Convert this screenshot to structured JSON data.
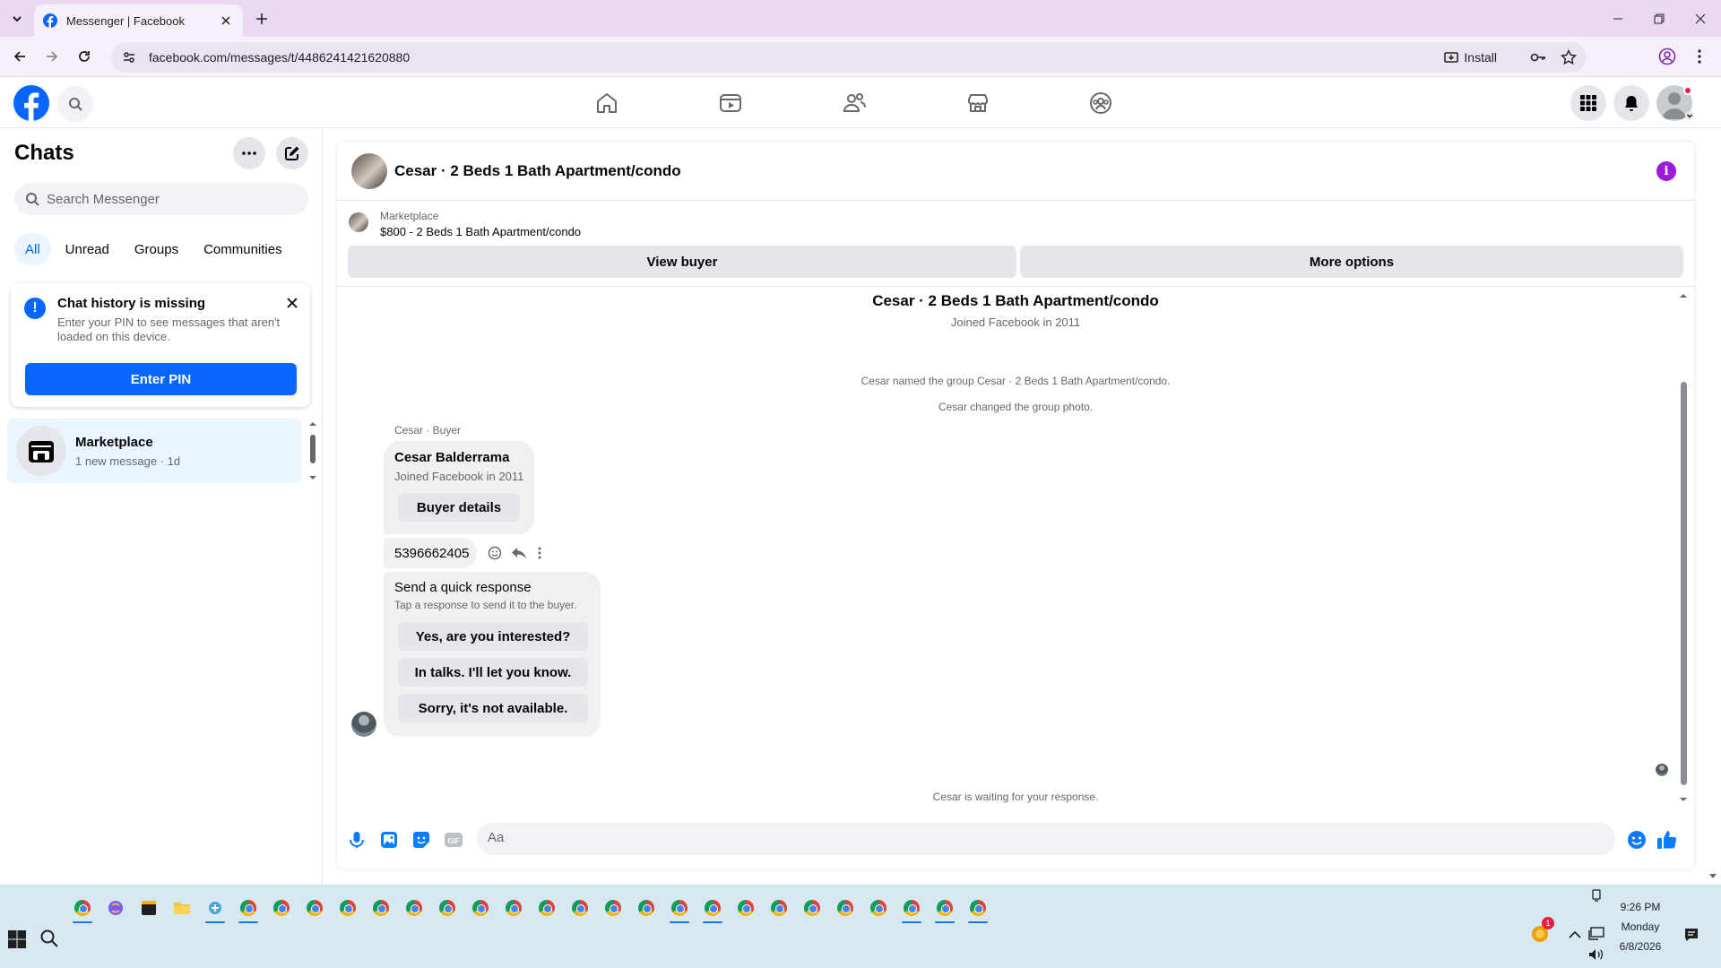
{
  "browser": {
    "tab_title": "Messenger | Facebook",
    "url": "facebook.com/messages/t/4486241421620880",
    "install_label": "Install"
  },
  "nav": {
    "tabs": [
      "home-icon",
      "video-icon",
      "friends-icon",
      "marketplace-icon",
      "groups-icon"
    ],
    "notification_dot": true
  },
  "chats": {
    "title": "Chats",
    "search_placeholder": "Search Messenger",
    "filters": [
      "All",
      "Unread",
      "Groups",
      "Communities"
    ],
    "active_filter": "All",
    "pin_card": {
      "title": "Chat history is missing",
      "description": "Enter your PIN to see messages that aren't loaded on this device.",
      "button": "Enter PIN"
    },
    "items": [
      {
        "name": "Marketplace",
        "subtitle": "1 new message · 1d"
      }
    ]
  },
  "conversation": {
    "title": "Cesar · 2 Beds 1 Bath Apartment/condo",
    "listing": {
      "kind": "Marketplace",
      "price_title": "$800 - 2 Beds 1 Bath Apartment/condo",
      "view_buyer": "View buyer",
      "more_options": "More options"
    },
    "thread": {
      "intro_title": "Cesar · 2 Beds 1 Bath Apartment/condo",
      "intro_sub": "Joined Facebook in 2011",
      "event_1": "Cesar named the group Cesar · 2 Beds 1 Bath Apartment/condo.",
      "event_2": "Cesar changed the group photo.",
      "sender_label": "Cesar · Buyer",
      "buyer_card": {
        "name": "Cesar Balderrama",
        "joined": "Joined Facebook in 2011",
        "button": "Buyer details"
      },
      "message": "5396662405",
      "quick": {
        "title": "Send a quick response",
        "subtitle": "Tap a response to send it to the buyer.",
        "options": [
          "Yes, are you interested?",
          "In talks. I'll let you know.",
          "Sorry, it's not available."
        ]
      },
      "waiting": "Cesar is waiting for your response."
    },
    "composer": {
      "placeholder": "Aa"
    }
  },
  "taskbar": {
    "time": "9:26 PM",
    "day": "Monday",
    "date": "6/8/2026",
    "notification_count": "1"
  },
  "colors": {
    "fb_blue": "#0866ff",
    "messenger_blue": "#0a7cff",
    "info_purple": "#9b1bd8",
    "chrome_tabbar": "#ead9f2",
    "taskbar": "#d6e9f3"
  }
}
